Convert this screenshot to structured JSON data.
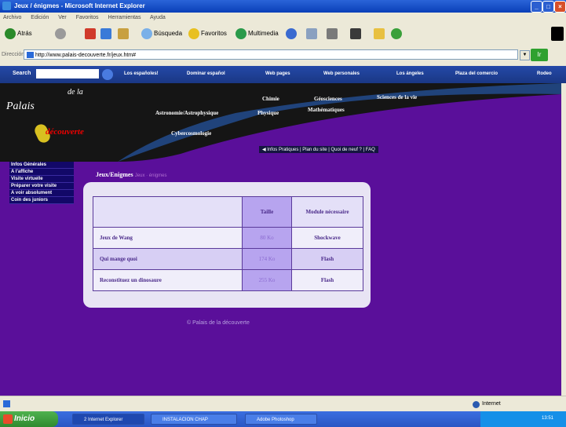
{
  "window": {
    "title": "Jeux / énigmes - Microsoft Internet Explorer",
    "min": "_",
    "max": "□",
    "close": "×"
  },
  "menu": [
    "Archivo",
    "Edición",
    "Ver",
    "Favoritos",
    "Herramientas",
    "Ayuda"
  ],
  "toolbar": {
    "back": "Atrás",
    "search": "Búsqueda",
    "favorites": "Favoritos",
    "multimedia": "Multimedia"
  },
  "address": {
    "label": "Dirección",
    "url": "http://www.palais-decouverte.fr/jeux.htm#",
    "go": "Ir"
  },
  "linksbar": {
    "search_label": "Search",
    "links": [
      "Los españoles!",
      "Dominar español",
      "Web pages",
      "Web personales",
      "Los ángeles",
      "Plaza del comercio",
      "Rodeo"
    ]
  },
  "site": {
    "logo_palais": "Palais",
    "logo_de": "de la",
    "logo_decouverte": "découverte",
    "topics": [
      "Astronomie/Astrophysique",
      "Chimie",
      "Physique",
      "Géosciences",
      "Mathématiques",
      "Sciences de la vie",
      "Cybercosmologie"
    ],
    "subnav": [
      "Infos Pratiques",
      "Plan du site",
      "Quoi de neuf ?",
      "FAQ"
    ],
    "sidenav": [
      "Infos Générales",
      "A l'affiche",
      "Visite virtuelle",
      "Préparer votre visite",
      "A voir absolument",
      "Coin des juniors"
    ],
    "breadcrumb_main": "Jeux/Enigmes",
    "breadcrumb_sub": "Jeux · énigmes",
    "table": {
      "col_size": "Taille",
      "col_module": "Module nécessaire",
      "rows": [
        {
          "name": "Jeux de Wang",
          "size": "80 Ko",
          "module": "Shockwave"
        },
        {
          "name": "Qui mange quoi",
          "size": "174 Ko",
          "module": "Flash"
        },
        {
          "name": "Reconstituez un dinosaure",
          "size": "255 Ko",
          "module": "Flash"
        }
      ]
    },
    "footer": "© Palais de la découverte"
  },
  "status": {
    "zone": "Internet"
  },
  "taskbar": {
    "start": "Inicio",
    "tasks": [
      "2 Internet Explorer",
      "INSTALACION CHAP",
      "Adobe Photoshop"
    ],
    "clock": "13:51"
  }
}
